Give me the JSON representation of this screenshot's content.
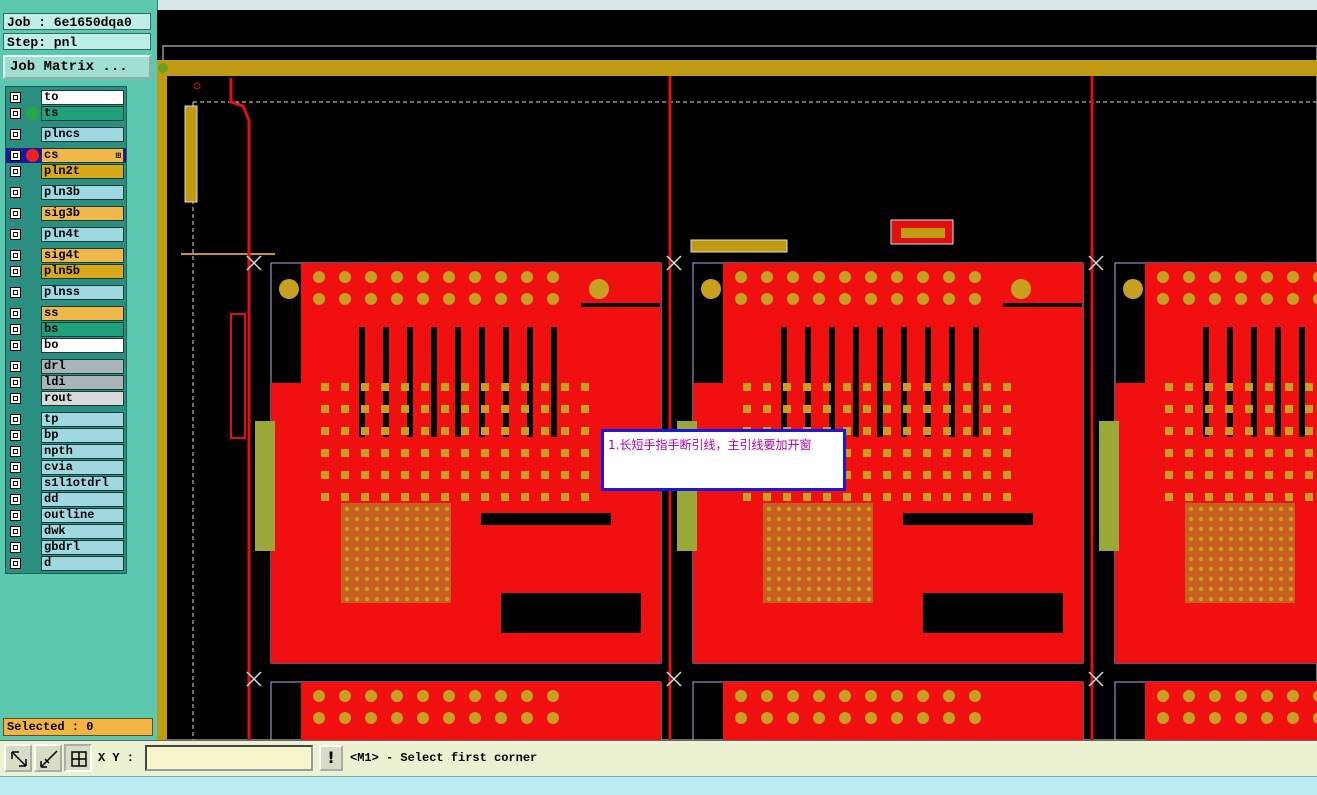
{
  "header": {
    "job": "Job : 6e1650dqa0",
    "step": "Step: pnl"
  },
  "job_matrix_label": "Job Matrix ...",
  "layers": [
    {
      "name": "to",
      "color": "#ffffff",
      "dot": ""
    },
    {
      "name": "ts",
      "color": "#1ea07a",
      "dot": "#22a84a"
    },
    {
      "name": "plncs",
      "color": "#9fd8e0",
      "dot": ""
    },
    {
      "name": "cs",
      "color": "#f0b84a",
      "dot": "#ee2020",
      "active": true,
      "marker": "⊞"
    },
    {
      "name": "pln2t",
      "color": "#d8a818",
      "dot": ""
    },
    {
      "name": "pln3b",
      "color": "#9fd8e0",
      "dot": ""
    },
    {
      "name": "sig3b",
      "color": "#f0b84a",
      "dot": ""
    },
    {
      "name": "pln4t",
      "color": "#9fd8e0",
      "dot": ""
    },
    {
      "name": "sig4t",
      "color": "#f0b84a",
      "dot": ""
    },
    {
      "name": "pln5b",
      "color": "#d8a818",
      "dot": ""
    },
    {
      "name": "plnss",
      "color": "#9fd8e0",
      "dot": ""
    },
    {
      "name": "ss",
      "color": "#f0b84a",
      "dot": ""
    },
    {
      "name": "bs",
      "color": "#1ea07a",
      "dot": ""
    },
    {
      "name": "bo",
      "color": "#ffffff",
      "dot": ""
    },
    {
      "name": "drl",
      "color": "#a8b4b8",
      "dot": ""
    },
    {
      "name": "ldi",
      "color": "#a8b4b8",
      "dot": ""
    },
    {
      "name": "rout",
      "color": "#d8d8d8",
      "dot": ""
    },
    {
      "name": "tp",
      "color": "#9fd8e0",
      "dot": ""
    },
    {
      "name": "bp",
      "color": "#9fd8e0",
      "dot": ""
    },
    {
      "name": "npth",
      "color": "#9fd8e0",
      "dot": ""
    },
    {
      "name": "cvia",
      "color": "#9fd8e0",
      "dot": ""
    },
    {
      "name": "s1l1otdrl",
      "color": "#9fd8e0",
      "dot": ""
    },
    {
      "name": "dd",
      "color": "#9fd8e0",
      "dot": ""
    },
    {
      "name": "outline",
      "color": "#9fd8e0",
      "dot": ""
    },
    {
      "name": "dwk",
      "color": "#9fd8e0",
      "dot": ""
    },
    {
      "name": "gbdrl",
      "color": "#9fd8e0",
      "dot": ""
    },
    {
      "name": "d",
      "color": "#9fd8e0",
      "dot": ""
    }
  ],
  "selected_label": "Selected : 0",
  "toolbar": {
    "xy_label": "X Y :",
    "xy_value": "",
    "alert_glyph": "!"
  },
  "status_message": "<M1> - Select first corner",
  "annotation_note": "1.长短手指手断引线，主引线要加开窗",
  "colors": {
    "copper": "#f01010",
    "pad": "#c8a020",
    "board_bg": "#000000"
  }
}
